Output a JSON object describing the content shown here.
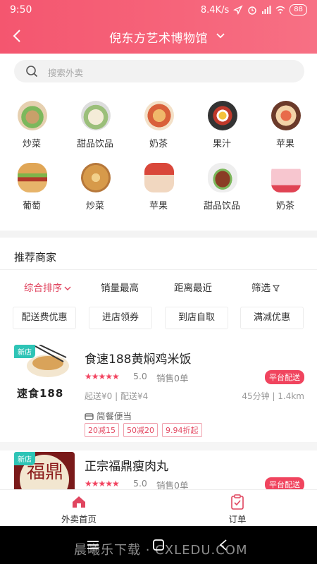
{
  "status_bar": {
    "time": "9:50",
    "network": "8.4K/s",
    "battery": "88"
  },
  "header": {
    "title": "倪东方艺术博物馆"
  },
  "search": {
    "placeholder": "搜索外卖"
  },
  "categories": [
    {
      "label": "炒菜",
      "icon": "stir-fry-icon"
    },
    {
      "label": "甜品饮品",
      "icon": "dessert-icon"
    },
    {
      "label": "奶茶",
      "icon": "milk-tea-icon"
    },
    {
      "label": "果汁",
      "icon": "juice-icon"
    },
    {
      "label": "苹果",
      "icon": "apple-icon"
    },
    {
      "label": "葡萄",
      "icon": "grape-icon"
    },
    {
      "label": "炒菜",
      "icon": "stir-fry-icon"
    },
    {
      "label": "苹果",
      "icon": "apple-icon"
    },
    {
      "label": "甜品饮品",
      "icon": "dessert-icon"
    },
    {
      "label": "奶茶",
      "icon": "milk-tea-icon"
    }
  ],
  "section": {
    "title": "推荐商家"
  },
  "sort_tabs": [
    "综合排序",
    "销量最高",
    "距离最近",
    "筛选"
  ],
  "filter_chips": [
    "配送费优惠",
    "进店领券",
    "到店自取",
    "满减优惠"
  ],
  "shops": [
    {
      "tag": "新店",
      "logo_text": "速食188",
      "name": "食速188黄焖鸡米饭",
      "stars": "★★★★★",
      "rating": "5.0",
      "sales": "销售0单",
      "platform_badge": "平台配送",
      "delivery": "起送¥0 | 配送¥4",
      "eta": "45分钟 | 1.4km",
      "meal": "简餐便当",
      "promos": [
        "20减15",
        "50减20",
        "9.94折起"
      ]
    },
    {
      "tag": "新店",
      "logo_text": "福鼎",
      "name": "正宗福鼎瘦肉丸",
      "stars": "★★★★★",
      "rating": "5.0",
      "sales": "销售0单",
      "platform_badge": "平台配送"
    }
  ],
  "tabbar": {
    "home": "外卖首页",
    "orders": "订单"
  },
  "watermark": "晨曦乐下载 · CXLEDU.COM",
  "colors": {
    "accent": "#f4566f",
    "tag": "#2ec4b6"
  }
}
